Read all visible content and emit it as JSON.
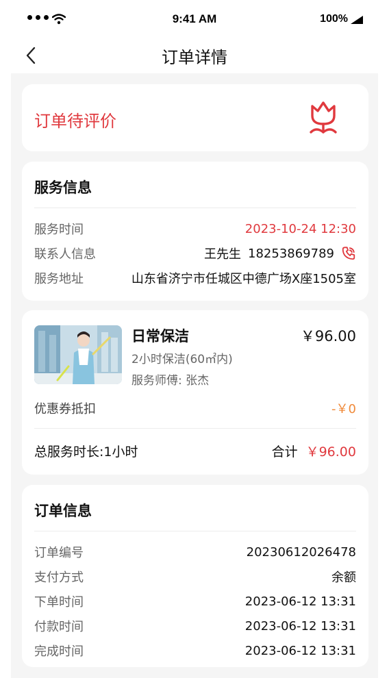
{
  "status_bar": {
    "time": "9:41 AM",
    "battery": "100%"
  },
  "nav": {
    "title": "订单详情",
    "back_icon": "chevron-left-icon"
  },
  "order_status": {
    "text": "订单待评价",
    "icon": "tulip-icon",
    "color": "#e0393e"
  },
  "service_info": {
    "title": "服务信息",
    "rows": [
      {
        "label": "服务时间",
        "value": "2023-10-24 12:30"
      },
      {
        "label": "联系人信息",
        "name": "王先生",
        "phone": "18253869789"
      },
      {
        "label": "服务地址",
        "value": "山东省济宁市任城区中德广场X座1505室"
      }
    ]
  },
  "product": {
    "name": "日常保洁",
    "price": "￥96.00",
    "spec": "2小时保洁(60㎡内)",
    "worker": "服务师傅: 张杰",
    "coupon_label": "优惠券抵扣",
    "coupon_value": "-￥0",
    "total_duration": "总服务时长:1小时",
    "total_label": "合计",
    "total_value": "￥96.00"
  },
  "order_info": {
    "title": "订单信息",
    "rows": [
      {
        "label": "订单编号",
        "value": "20230612026478"
      },
      {
        "label": "支付方式",
        "value": "余额"
      },
      {
        "label": "下单时间",
        "value": "2023-06-12 13:31"
      },
      {
        "label": "付款时间",
        "value": "2023-06-12 13:31"
      },
      {
        "label": "完成时间",
        "value": "2023-06-12 13:31"
      }
    ]
  },
  "colors": {
    "accent_red": "#e0393e",
    "coupon_orange": "#f08a3a",
    "background": "#f5f5f5"
  }
}
